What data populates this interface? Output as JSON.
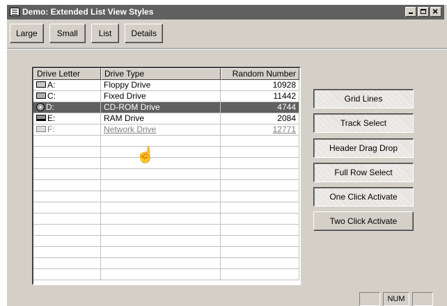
{
  "window": {
    "title": "Demo: Extended List View Styles"
  },
  "toolbar": {
    "buttons": [
      "Large",
      "Small",
      "List",
      "Details"
    ]
  },
  "listview": {
    "columns": [
      "Drive Letter",
      "Drive Type",
      "Random Number"
    ],
    "rows": [
      {
        "letter": "A:",
        "type": "Floppy Drive",
        "number": "10928",
        "icon": "floppy-drive-icon",
        "state": "normal"
      },
      {
        "letter": "C:",
        "type": "Fixed Drive",
        "number": "11442",
        "icon": "hard-drive-icon",
        "state": "normal"
      },
      {
        "letter": "D:",
        "type": "CD-ROM Drive",
        "number": "4744",
        "icon": "cdrom-drive-icon",
        "state": "selected"
      },
      {
        "letter": "E:",
        "type": "RAM Drive",
        "number": "2084",
        "icon": "ram-drive-icon",
        "state": "normal"
      },
      {
        "letter": "F:",
        "type": "Network Drive",
        "number": "12771",
        "icon": "network-drive-icon",
        "state": "hot"
      }
    ],
    "empty_rows": 13
  },
  "side_buttons": [
    {
      "label": "Grid Lines",
      "pressed": true
    },
    {
      "label": "Track Select",
      "pressed": true
    },
    {
      "label": "Header Drag Drop",
      "pressed": true
    },
    {
      "label": "Full Row Select",
      "pressed": true
    },
    {
      "label": "One Click Activate",
      "pressed": true
    },
    {
      "label": "Two Click Activate",
      "pressed": false
    }
  ],
  "statusbar": {
    "num": "NUM"
  },
  "colors": {
    "selection": "#606060",
    "face": "#d4d0c8",
    "hot_text": "#808080"
  }
}
